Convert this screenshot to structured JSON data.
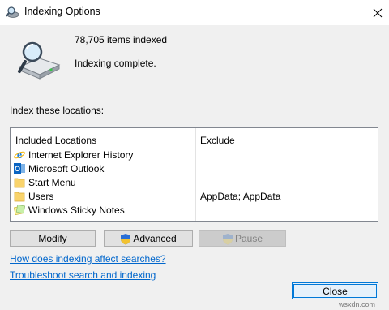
{
  "window": {
    "title": "Indexing Options",
    "close_glyph": "✕"
  },
  "summary": {
    "items_indexed": "78,705 items indexed",
    "status": "Indexing complete."
  },
  "locations": {
    "section_label": "Index these locations:",
    "headers": {
      "included": "Included Locations",
      "exclude": "Exclude"
    },
    "rows": [
      {
        "icon": "internet-explorer-icon",
        "name": "Internet Explorer History",
        "exclude": ""
      },
      {
        "icon": "outlook-icon",
        "name": "Microsoft Outlook",
        "exclude": ""
      },
      {
        "icon": "folder-icon",
        "name": "Start Menu",
        "exclude": ""
      },
      {
        "icon": "folder-icon",
        "name": "Users",
        "exclude": "AppData; AppData"
      },
      {
        "icon": "sticky-notes-icon",
        "name": "Windows Sticky Notes",
        "exclude": ""
      }
    ]
  },
  "buttons": {
    "modify": "Modify",
    "advanced": "Advanced",
    "pause": "Pause",
    "close": "Close"
  },
  "links": {
    "how_indexing": "How does indexing affect searches?",
    "troubleshoot": "Troubleshoot search and indexing"
  },
  "watermark": "wsxdn.com"
}
